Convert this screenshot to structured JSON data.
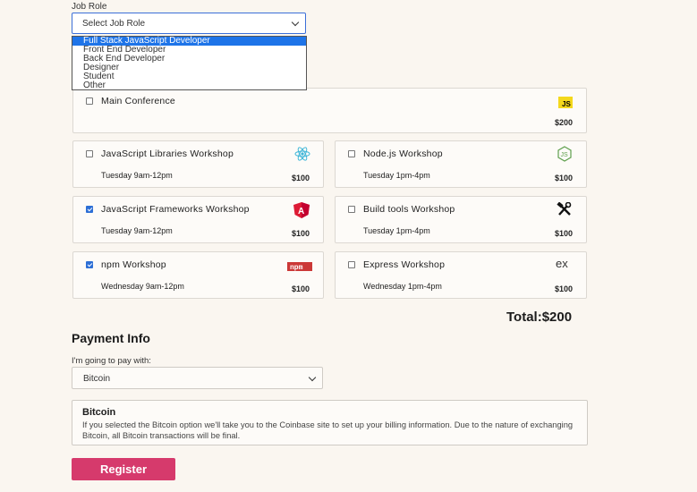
{
  "job_role": {
    "label": "Job Role",
    "selected": "Select Job Role",
    "options": [
      "Full Stack JavaScript Developer",
      "Front End Developer",
      "Back End Developer",
      "Designer",
      "Student",
      "Other"
    ],
    "highlighted_index": 0
  },
  "main_conference": {
    "name": "Main Conference",
    "price": "$200",
    "checked": false,
    "icon": "js-icon"
  },
  "workshops": [
    {
      "name": "JavaScript Libraries Workshop",
      "time": "Tuesday 9am-12pm",
      "price": "$100",
      "checked": false,
      "icon": "react-icon"
    },
    {
      "name": "Node.js Workshop",
      "time": "Tuesday 1pm-4pm",
      "price": "$100",
      "checked": false,
      "icon": "nodejs-icon"
    },
    {
      "name": "JavaScript Frameworks Workshop",
      "time": "Tuesday 9am-12pm",
      "price": "$100",
      "checked": true,
      "icon": "angular-icon"
    },
    {
      "name": "Build tools Workshop",
      "time": "Tuesday 1pm-4pm",
      "price": "$100",
      "checked": false,
      "icon": "tools-icon"
    },
    {
      "name": "npm Workshop",
      "time": "Wednesday 9am-12pm",
      "price": "$100",
      "checked": true,
      "icon": "npm-icon"
    },
    {
      "name": "Express Workshop",
      "time": "Wednesday 1pm-4pm",
      "price": "$100",
      "checked": false,
      "icon": "express-icon"
    }
  ],
  "total": "Total:$200",
  "payment": {
    "title": "Payment Info",
    "label": "I'm going to pay with:",
    "selected": "Bitcoin",
    "info_title": "Bitcoin",
    "info_text": "If you selected the Bitcoin option we'll take you to the Coinbase site to set up your billing information. Due to the nature of exchanging Bitcoin, all Bitcoin transactions will be final."
  },
  "register_label": "Register",
  "colors": {
    "accent": "#d63a6c",
    "background": "#faf6f0",
    "select_highlight": "#1e74e8",
    "checkbox_checked": "#2d6fd6"
  }
}
